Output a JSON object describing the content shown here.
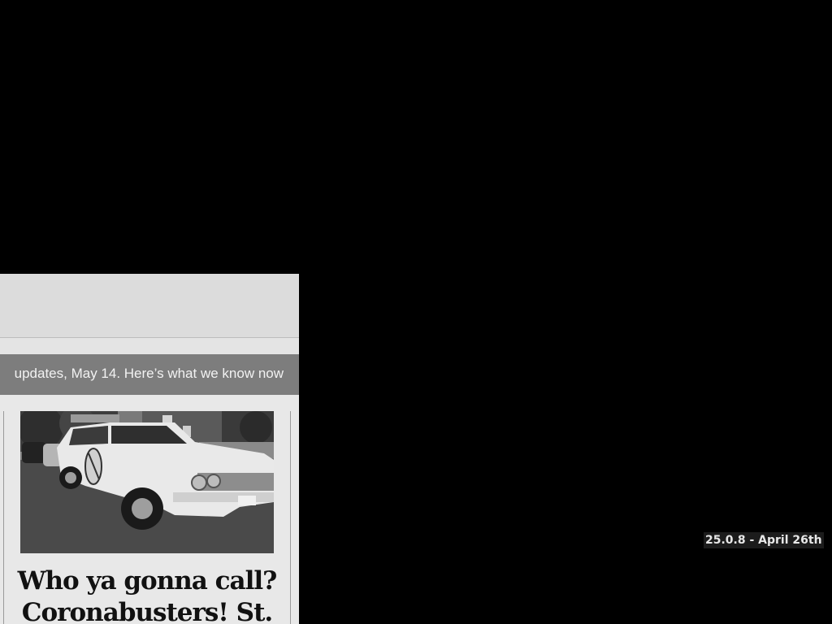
{
  "ticker": {
    "text": "updates, May 14. Here’s what we know now"
  },
  "story": {
    "image_alt": "Vintage white station wagon with logo on door parked on street",
    "headline": "Who ya gonna call? Coronabusters! St."
  },
  "overlay": {
    "version": "25.0.8 - April 26th"
  },
  "colors": {
    "desktop_background": "#000000",
    "ticker_background": "#7d7d7d",
    "page_background": "#e8e8e8"
  }
}
